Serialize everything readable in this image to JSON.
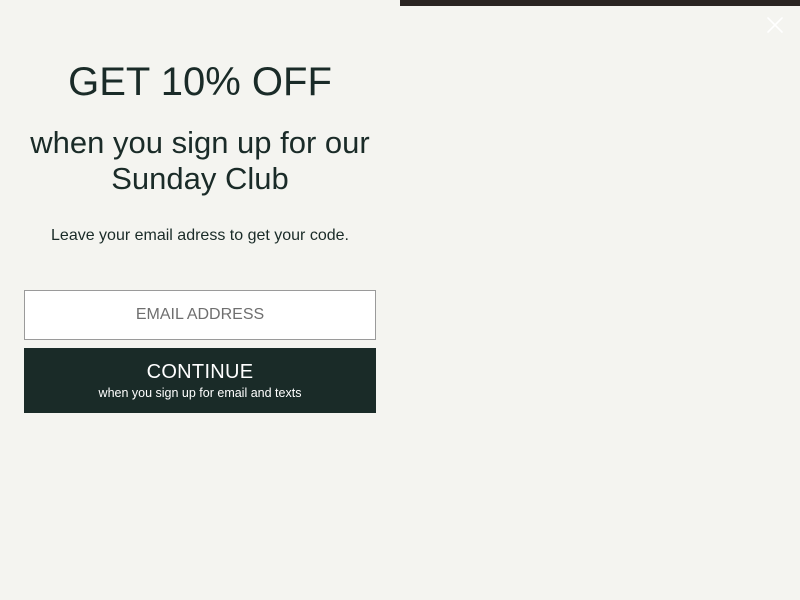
{
  "popup": {
    "headline": "GET 10% OFF",
    "subheadline_line1": "when you sign up for our",
    "subheadline_line2": "Sunday Club",
    "instructions": "Leave your email adress to get your code.",
    "email_placeholder": "EMAIL ADDRESS",
    "email_value": "",
    "continue_label": "CONTINUE",
    "continue_sublabel": "when you sign up for email and texts",
    "close_icon": "close-icon"
  },
  "colors": {
    "background": "#f4f4f0",
    "primary": "#1a2b28",
    "button_text": "#ffffff",
    "input_border": "#9a9a9a",
    "image_strip": "#2a2422"
  }
}
